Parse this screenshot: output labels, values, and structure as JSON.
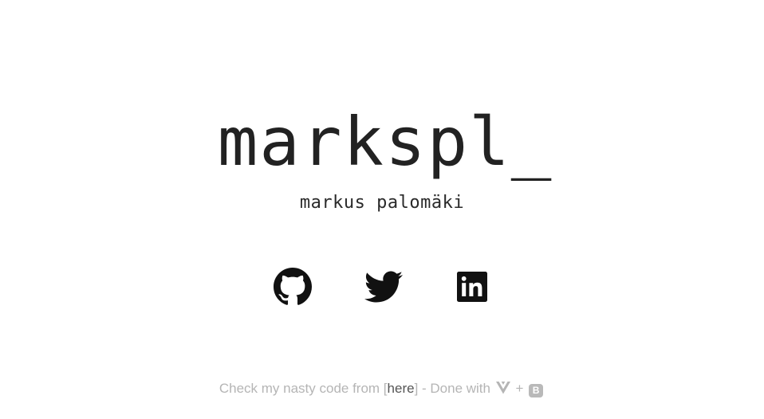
{
  "hero": {
    "title": "markspl_",
    "subtitle": "markus palomäki"
  },
  "social": [
    {
      "name": "github",
      "icon": "github-icon"
    },
    {
      "name": "twitter",
      "icon": "twitter-icon"
    },
    {
      "name": "linkedin",
      "icon": "linkedin-icon"
    }
  ],
  "footer": {
    "prefix": "Check my nasty code from [",
    "link_text": "here",
    "suffix": "] - Done with",
    "plus": "+",
    "vue_icon": "vue-logo-icon",
    "bootstrap_icon": "bootstrap-logo-icon",
    "bootstrap_letter": "B"
  },
  "colors": {
    "text": "#222222",
    "footer_text": "#b5b5b5",
    "footer_link": "#555555",
    "icon": "#111111"
  }
}
